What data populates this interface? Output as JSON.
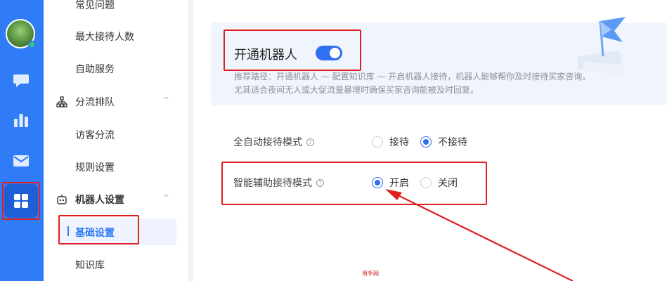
{
  "rail": {
    "icons": [
      "chat-icon",
      "stats-icon",
      "mail-icon",
      "apps-icon"
    ],
    "accent": "#2f7cf6"
  },
  "menu": {
    "items": {
      "faq": "常见问题",
      "max_reception": "最大接待人数",
      "self_service": "自助服务",
      "group_queue": "分流排队",
      "visitor_split": "访客分流",
      "rule_settings": "规则设置",
      "robot_settings": "机器人设置",
      "basic_settings": "基础设置",
      "knowledge_base": "知识库"
    },
    "chevron": "^"
  },
  "banner": {
    "title": "开通机器人",
    "toggle_on": true,
    "desc_line1": "推荐路径：开通机器人 — 配置知识库 — 开启机器人接待，机器人能够帮你及时接待买家咨询。",
    "desc_line2": "尤其适合夜间无人或大促流量暴增时确保买家咨询能被及时回复。"
  },
  "settings": {
    "auto_mode": {
      "label": "全自动接待模式",
      "help": "?",
      "option_on": "接待",
      "option_off": "不接待",
      "selected": "off"
    },
    "assist_mode": {
      "label": "智能辅助接待模式",
      "help": "?",
      "option_on": "开启",
      "option_off": "关闭",
      "selected": "on"
    }
  },
  "watermark": "用手网",
  "colors": {
    "primary": "#2f6ff0",
    "annotation": "#e02020"
  }
}
